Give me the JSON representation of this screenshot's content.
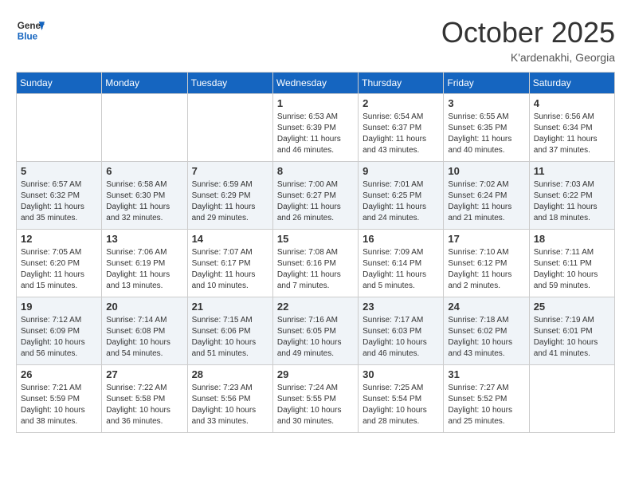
{
  "header": {
    "logo_line1": "General",
    "logo_line2": "Blue",
    "month": "October 2025",
    "location": "K'ardenakhi, Georgia"
  },
  "days_of_week": [
    "Sunday",
    "Monday",
    "Tuesday",
    "Wednesday",
    "Thursday",
    "Friday",
    "Saturday"
  ],
  "weeks": [
    [
      {
        "day": "",
        "info": ""
      },
      {
        "day": "",
        "info": ""
      },
      {
        "day": "",
        "info": ""
      },
      {
        "day": "1",
        "info": "Sunrise: 6:53 AM\nSunset: 6:39 PM\nDaylight: 11 hours\nand 46 minutes."
      },
      {
        "day": "2",
        "info": "Sunrise: 6:54 AM\nSunset: 6:37 PM\nDaylight: 11 hours\nand 43 minutes."
      },
      {
        "day": "3",
        "info": "Sunrise: 6:55 AM\nSunset: 6:35 PM\nDaylight: 11 hours\nand 40 minutes."
      },
      {
        "day": "4",
        "info": "Sunrise: 6:56 AM\nSunset: 6:34 PM\nDaylight: 11 hours\nand 37 minutes."
      }
    ],
    [
      {
        "day": "5",
        "info": "Sunrise: 6:57 AM\nSunset: 6:32 PM\nDaylight: 11 hours\nand 35 minutes."
      },
      {
        "day": "6",
        "info": "Sunrise: 6:58 AM\nSunset: 6:30 PM\nDaylight: 11 hours\nand 32 minutes."
      },
      {
        "day": "7",
        "info": "Sunrise: 6:59 AM\nSunset: 6:29 PM\nDaylight: 11 hours\nand 29 minutes."
      },
      {
        "day": "8",
        "info": "Sunrise: 7:00 AM\nSunset: 6:27 PM\nDaylight: 11 hours\nand 26 minutes."
      },
      {
        "day": "9",
        "info": "Sunrise: 7:01 AM\nSunset: 6:25 PM\nDaylight: 11 hours\nand 24 minutes."
      },
      {
        "day": "10",
        "info": "Sunrise: 7:02 AM\nSunset: 6:24 PM\nDaylight: 11 hours\nand 21 minutes."
      },
      {
        "day": "11",
        "info": "Sunrise: 7:03 AM\nSunset: 6:22 PM\nDaylight: 11 hours\nand 18 minutes."
      }
    ],
    [
      {
        "day": "12",
        "info": "Sunrise: 7:05 AM\nSunset: 6:20 PM\nDaylight: 11 hours\nand 15 minutes."
      },
      {
        "day": "13",
        "info": "Sunrise: 7:06 AM\nSunset: 6:19 PM\nDaylight: 11 hours\nand 13 minutes."
      },
      {
        "day": "14",
        "info": "Sunrise: 7:07 AM\nSunset: 6:17 PM\nDaylight: 11 hours\nand 10 minutes."
      },
      {
        "day": "15",
        "info": "Sunrise: 7:08 AM\nSunset: 6:16 PM\nDaylight: 11 hours\nand 7 minutes."
      },
      {
        "day": "16",
        "info": "Sunrise: 7:09 AM\nSunset: 6:14 PM\nDaylight: 11 hours\nand 5 minutes."
      },
      {
        "day": "17",
        "info": "Sunrise: 7:10 AM\nSunset: 6:12 PM\nDaylight: 11 hours\nand 2 minutes."
      },
      {
        "day": "18",
        "info": "Sunrise: 7:11 AM\nSunset: 6:11 PM\nDaylight: 10 hours\nand 59 minutes."
      }
    ],
    [
      {
        "day": "19",
        "info": "Sunrise: 7:12 AM\nSunset: 6:09 PM\nDaylight: 10 hours\nand 56 minutes."
      },
      {
        "day": "20",
        "info": "Sunrise: 7:14 AM\nSunset: 6:08 PM\nDaylight: 10 hours\nand 54 minutes."
      },
      {
        "day": "21",
        "info": "Sunrise: 7:15 AM\nSunset: 6:06 PM\nDaylight: 10 hours\nand 51 minutes."
      },
      {
        "day": "22",
        "info": "Sunrise: 7:16 AM\nSunset: 6:05 PM\nDaylight: 10 hours\nand 49 minutes."
      },
      {
        "day": "23",
        "info": "Sunrise: 7:17 AM\nSunset: 6:03 PM\nDaylight: 10 hours\nand 46 minutes."
      },
      {
        "day": "24",
        "info": "Sunrise: 7:18 AM\nSunset: 6:02 PM\nDaylight: 10 hours\nand 43 minutes."
      },
      {
        "day": "25",
        "info": "Sunrise: 7:19 AM\nSunset: 6:01 PM\nDaylight: 10 hours\nand 41 minutes."
      }
    ],
    [
      {
        "day": "26",
        "info": "Sunrise: 7:21 AM\nSunset: 5:59 PM\nDaylight: 10 hours\nand 38 minutes."
      },
      {
        "day": "27",
        "info": "Sunrise: 7:22 AM\nSunset: 5:58 PM\nDaylight: 10 hours\nand 36 minutes."
      },
      {
        "day": "28",
        "info": "Sunrise: 7:23 AM\nSunset: 5:56 PM\nDaylight: 10 hours\nand 33 minutes."
      },
      {
        "day": "29",
        "info": "Sunrise: 7:24 AM\nSunset: 5:55 PM\nDaylight: 10 hours\nand 30 minutes."
      },
      {
        "day": "30",
        "info": "Sunrise: 7:25 AM\nSunset: 5:54 PM\nDaylight: 10 hours\nand 28 minutes."
      },
      {
        "day": "31",
        "info": "Sunrise: 7:27 AM\nSunset: 5:52 PM\nDaylight: 10 hours\nand 25 minutes."
      },
      {
        "day": "",
        "info": ""
      }
    ]
  ]
}
